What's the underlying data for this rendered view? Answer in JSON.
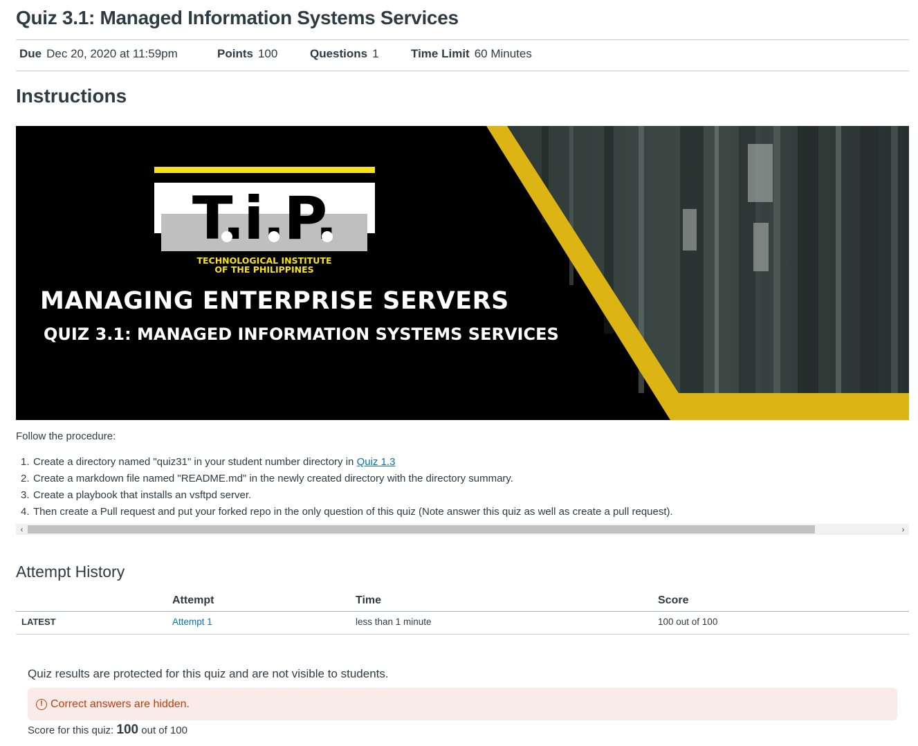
{
  "page": {
    "title": "Quiz 3.1: Managed Information Systems Services"
  },
  "meta": {
    "due_label": "Due",
    "due_value": "Dec 20, 2020 at 11:59pm",
    "points_label": "Points",
    "points_value": "100",
    "questions_label": "Questions",
    "questions_value": "1",
    "time_limit_label": "Time Limit",
    "time_limit_value": "60 Minutes"
  },
  "instructions": {
    "heading": "Instructions",
    "banner": {
      "logo_text": "T.i.P.",
      "logo_caption_line1": "TECHNOLOGICAL INSTITUTE",
      "logo_caption_line2": "OF THE PHILIPPINES",
      "title": "MANAGING ENTERPRISE SERVERS",
      "subtitle": "QUIZ 3.1: MANAGED INFORMATION SYSTEMS SERVICES",
      "colors": {
        "background": "#000000",
        "accent": "#dcb515",
        "logo_yellow": "#f6e219"
      }
    },
    "intro": "Follow the procedure:",
    "steps": [
      {
        "num": "1.",
        "text": "Create a directory named \"quiz31\" in your student number directory in ",
        "link": "Quiz 1.3"
      },
      {
        "num": "2.",
        "text": "Create a markdown file named \"README.md\" in the newly created directory with the directory summary."
      },
      {
        "num": "3.",
        "text": "Create a playbook that installs an vsftpd server."
      },
      {
        "num": "4.",
        "text": "Then create a Pull request and put your forked repo in the only question of this quiz (Note answer this quiz as well as create a pull request)."
      }
    ]
  },
  "attempt_history": {
    "heading": "Attempt History",
    "columns": [
      "",
      "Attempt",
      "Time",
      "Score"
    ],
    "rows": [
      {
        "label": "LATEST",
        "attempt": "Attempt 1",
        "time": "less than 1 minute",
        "score": "100 out of 100"
      }
    ]
  },
  "results": {
    "protected_note": "Quiz results are protected for this quiz and are not visible to students.",
    "alert_text": "Correct answers are hidden.",
    "alert_icon": "exclamation-circle-icon",
    "score_prefix": "Score for this quiz:",
    "score_value": "100",
    "score_suffix": "out of 100"
  }
}
